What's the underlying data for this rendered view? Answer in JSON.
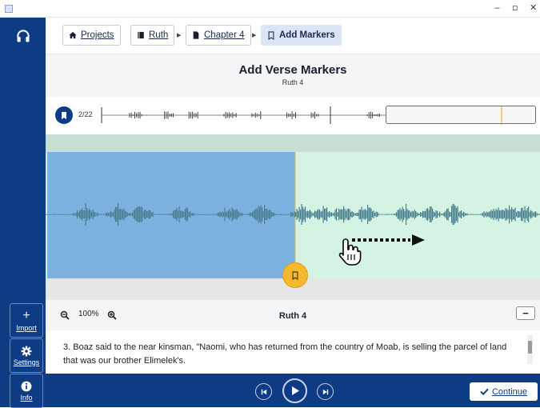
{
  "window": {
    "minimize": "‒",
    "maximize": "▫",
    "close": "✕"
  },
  "sidebar": {
    "top_icon": "headphones-icon",
    "import_label": "Import",
    "settings_label": "Settings",
    "info_label": "Info"
  },
  "breadcrumb": {
    "projects": "Projects",
    "ruth": "Ruth",
    "chapter": "Chapter 4",
    "current": "Add Markers"
  },
  "page": {
    "title": "Add Verse Markers",
    "subtitle": "Ruth 4"
  },
  "timeline": {
    "marker_count": "2/22"
  },
  "zoom": {
    "level": "100%"
  },
  "chapter_label": "Ruth 4",
  "verse_text": "3. Boaz said to the near kinsman, \"Naomi, who has returned from the country of Moab, is selling the parcel of land that was our brother Elimelek's.",
  "footer": {
    "continue_label": "Continue"
  },
  "colors": {
    "sidebar": "#0d3b84",
    "selected_region": "#7cb2e0",
    "unselected_region": "#d3ede0",
    "marker": "#f5b82e",
    "waveform": "#4a7f8f"
  }
}
